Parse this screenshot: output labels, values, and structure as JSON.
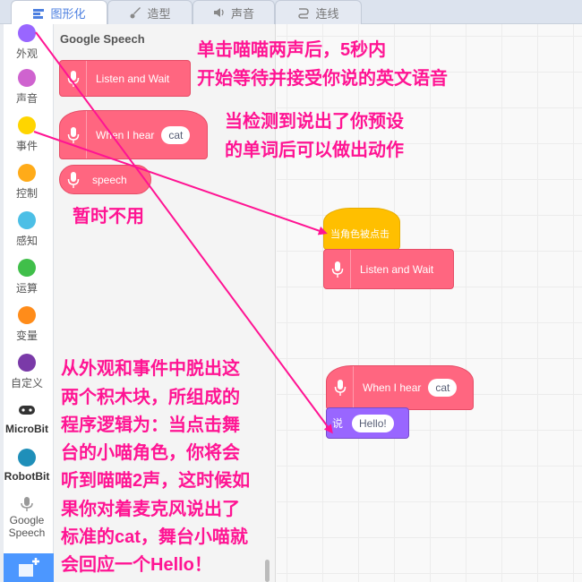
{
  "tabs": [
    {
      "label": "图形化",
      "active": true
    },
    {
      "label": "造型",
      "active": false
    },
    {
      "label": "声音",
      "active": false
    },
    {
      "label": "连线",
      "active": false
    }
  ],
  "categories": [
    {
      "label": "外观",
      "color": "#9966ff"
    },
    {
      "label": "声音",
      "color": "#cf63cf"
    },
    {
      "label": "事件",
      "color": "#ffd500"
    },
    {
      "label": "控制",
      "color": "#ffab19"
    },
    {
      "label": "感知",
      "color": "#4cbfe6"
    },
    {
      "label": "运算",
      "color": "#40bf4a"
    },
    {
      "label": "变量",
      "color": "#ff8c1a"
    },
    {
      "label": "自定义",
      "color": "#7a3aa8"
    },
    {
      "label": "MicroBit",
      "color": "#333333"
    },
    {
      "label": "RobotBit",
      "color": "#1f8fb9"
    },
    {
      "label_line1": "Google",
      "label_line2": "Speech",
      "color": "#999999"
    }
  ],
  "flyout": {
    "title": "Google Speech",
    "blocks": {
      "listen": "Listen and Wait",
      "when_hear": "When I hear",
      "when_hear_value": "cat",
      "speech": "speech"
    }
  },
  "workspace": {
    "event_hat": "当角色被点击",
    "listen": "Listen and Wait",
    "when_hear": "When I hear",
    "when_hear_value": "cat",
    "say": "说",
    "say_value": "Hello!"
  },
  "notes": {
    "top_line1": "单击喵喵两声后，5秒内",
    "top_line2": "开始等待并接受你说的英文语音",
    "mid_line1": "当检测到说出了你预设",
    "mid_line2": "的单词后可以做出动作",
    "unused": "暂时不用",
    "bottom": [
      "从外观和事件中脱出这",
      "两个积木块，所组成的",
      "程序逻辑为：当点击舞",
      "台的小喵角色，你将会",
      "听到喵喵2声，这时候如",
      "果你对着麦克风说出了",
      "标准的cat，舞台小喵就",
      "会回应一个Hello！"
    ]
  },
  "colors": {
    "speech_block": "#ff6680",
    "event_block": "#ffbf00",
    "looks_block": "#9966ff",
    "annotation": "#ff1493",
    "active_tab": "#4c7fe0"
  }
}
